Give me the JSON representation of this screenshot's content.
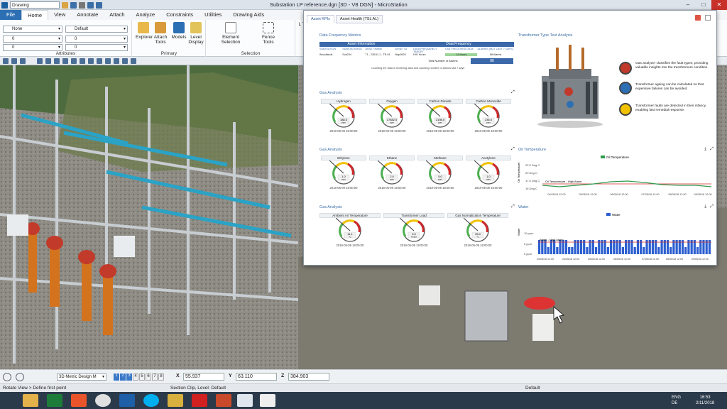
{
  "titlebar": {
    "workspace": "Drawing",
    "title": "Substation LP reference.dgn [3D - V8 DGN] - MicroStation",
    "min": "–",
    "max": "□",
    "close": "✕"
  },
  "tabs": [
    "File",
    "Home",
    "View",
    "Annotate",
    "Attach",
    "Analyze",
    "Constraints",
    "Utilities",
    "Drawing Aids"
  ],
  "ribbon": {
    "attributes": {
      "label": "Attributes",
      "level": "None",
      "style": "Default",
      "weight1": "0",
      "weight2": "0",
      "weight3": "0",
      "weight4": "0"
    },
    "primary": {
      "label": "Primary",
      "explorer": "Explorer",
      "attach_tools": "Attach Tools",
      "models": "Models",
      "level_display": "Level Display"
    },
    "selection": {
      "label": "Selection",
      "element_selection": "Element Selection",
      "fence_tools": "Fence Tools"
    },
    "partial": "L T"
  },
  "dashboard": {
    "tabs": [
      "Asset KPIs",
      "Asset Health (TSL AL)"
    ],
    "data_freq": {
      "title": "Data Frequency Metrics",
      "asset_info": "Asset Information",
      "data_freq": "Data Frequency",
      "cols": [
        "SUBSTATION",
        "SUBSTATION ID",
        "ASSET NAME",
        "ASSET ID",
        "DATA FREQUENCY TARGET",
        "LAST RECEIVED DATA",
        "ALARMS (NOT LAST 7 DAYS)"
      ],
      "row": [
        "Woodlands",
        "Sub234",
        "T1 - 230/11.1 - TR-01",
        "Map0002",
        "HIG Hours",
        "14 Hours",
        "88 Alarms"
      ],
      "total_label": "Total Number of Alarms",
      "total_value": "88",
      "note": "Counting the data in receiving data and counting number of alarms last 7 days"
    },
    "transformer": {
      "title": "Transformer Type Test Analysis",
      "notes": [
        "Gas analyzer classifies the fault types, providing valuable insights into the transformers condition.",
        "Transformer ageing can be calculated so that expensive failures can be avoided.",
        "Transformer faults are detected in their infancy, enabling fast remedial response."
      ]
    },
    "gas1": {
      "title": "Gas Analysis",
      "gauges": [
        {
          "label": "Hydrogen",
          "value": "188.0",
          "unit": "ppm",
          "date": "2018-05-09 18:00:00"
        },
        {
          "label": "Oxygen",
          "value": "17882.0",
          "unit": "ppm",
          "date": "2018-05-09 18:00:00"
        },
        {
          "label": "Carbon Dioxide",
          "value": "2198.0",
          "unit": "ppm",
          "date": "2018-05-09 18:00:00"
        },
        {
          "label": "Carbon Monoxide",
          "value": "236.0",
          "unit": "ppm",
          "date": "2018-05-09 18:00:00"
        }
      ]
    },
    "gas2": {
      "title": "Gas Analysis",
      "gauges": [
        {
          "label": "Ethylene",
          "value": "1.0",
          "unit": "ppm",
          "date": "2018-05-09 18:00:00"
        },
        {
          "label": "Ethane",
          "value": "2.0",
          "unit": "ppm",
          "date": "2018-05-09 18:00:00"
        },
        {
          "label": "Methane",
          "value": "5.0",
          "unit": "ppm",
          "date": "2018-05-09 18:00:00"
        },
        {
          "label": "Acetylene",
          "value": "1.0",
          "unit": "ppm",
          "date": "2018-05-09 18:00:00"
        }
      ]
    },
    "gas3": {
      "title": "Gas Analysis",
      "gauges": [
        {
          "label": "Ambient Air Temperature",
          "value": "11.1",
          "unit": "°C",
          "date": "2018-05-09 18:00:00"
        },
        {
          "label": "Transformer Load",
          "value": "0.0",
          "unit": "Amps",
          "date": "2018-05-09 18:00:00"
        },
        {
          "label": "Gas Normalization Temperature",
          "value": "35.0",
          "unit": "°C",
          "date": "2018-05-09 18:00:00"
        }
      ]
    },
    "oil": {
      "title": "Oil Temperature",
      "legend": "Oil Temperature",
      "ylabel": "Oil Temperature",
      "alarm": "Oil Temperature - High Alarm",
      "yticks": [
        "22.5 Deg C",
        "20 Deg C",
        "17.5 Deg C",
        "15 Deg C"
      ],
      "xticks": [
        "04/05/18 12:00",
        "05/05/18 12:00",
        "06/05/18 12:00",
        "07/05/18 12:00",
        "08/05/18 12:00",
        "09/05/18 12:00"
      ]
    },
    "water": {
      "title": "Water",
      "legend": "Water",
      "ylabel": "Water",
      "alarm": "Water - High Alarm",
      "yticks": [
        "10 ppm",
        "5 ppm",
        "0 ppm"
      ],
      "xticks": [
        "03/05/18 12:00",
        "04/05/18 12:00",
        "05/05/18 12:00",
        "06/05/18 12:00",
        "07/05/18 12:00",
        "08/05/18 12:00",
        "09/05/18 12:00"
      ]
    }
  },
  "statusbar": {
    "view_mode": "3D Metric Design M",
    "views": [
      "1",
      "2",
      "3",
      "4",
      "5",
      "6",
      "7",
      "8"
    ],
    "x_label": "X",
    "x_value": "55.937",
    "y_label": "Y",
    "y_value": "63.110",
    "z_label": "Z",
    "z_value": "384.903",
    "prompt": "Rotate View > Define first point",
    "clip": "Section Clip, Level: Default",
    "level": "Default"
  },
  "taskbar": {
    "lang": "ENG",
    "region": "DE",
    "time": "16:53",
    "date": "2/11/2018"
  },
  "colors": {
    "accent": "#2d6fb3",
    "dashboard_blue": "#3a68a8",
    "green": "#2e9a4a",
    "alarm": "#d0282a"
  }
}
